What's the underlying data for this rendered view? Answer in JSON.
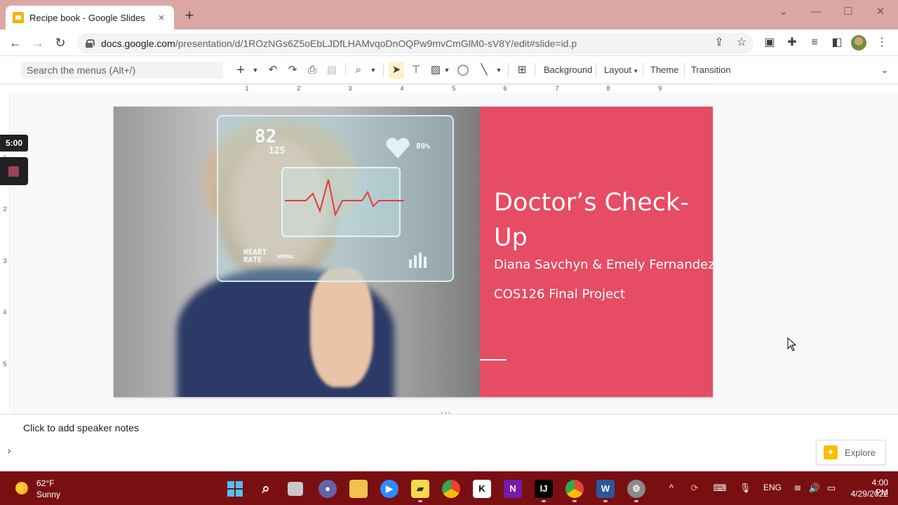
{
  "browser": {
    "tab_title": "Recipe book - Google Slides",
    "tab_close": "×",
    "new_tab": "+",
    "url_domain": "docs.google.com",
    "url_path": "/presentation/d/1ROzNGs6Z5oEbLJDfLHAMvqoDnOQPw9mvCmGlM0-sV8Y/edit#slide=id.p",
    "window_controls": [
      "⌄",
      "—",
      "☐",
      "✕"
    ]
  },
  "slides_toolbar": {
    "search_placeholder": "Search the menus (Alt+/)",
    "background_label": "Background",
    "layout_label": "Layout",
    "theme_label": "Theme",
    "transition_label": "Transition"
  },
  "ruler": {
    "h_numbers": [
      "1",
      "2",
      "3",
      "4",
      "5",
      "6",
      "7",
      "8",
      "9"
    ],
    "v_numbers": [
      "1",
      "2",
      "3",
      "4",
      "5"
    ]
  },
  "timer": {
    "value": "5:00"
  },
  "slide": {
    "title": "Doctor’s Check-Up",
    "subtitle": "Diana Savchyn & Emely Fernandez",
    "course": "COS126 Final Project",
    "panel_color": "#e64c63",
    "holo": {
      "bpm": "82",
      "bpm_small": "125",
      "percent": "89%",
      "heart_rate": "HEART RATE",
      "normal": "NORMAL"
    }
  },
  "notes": {
    "placeholder": "Click to add speaker notes"
  },
  "explore": {
    "label": "Explore"
  },
  "taskbar": {
    "weather_temp": "62°F",
    "weather_desc": "Sunny",
    "language": "ENG",
    "time": "4:00 PM",
    "date": "4/29/2022",
    "onenote_label": "N",
    "word_label": "W"
  }
}
